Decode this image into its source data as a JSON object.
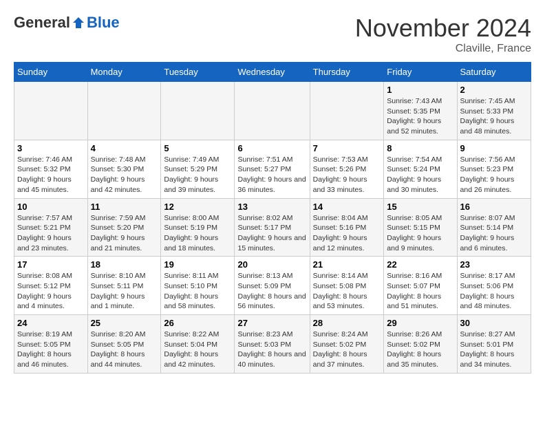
{
  "header": {
    "logo_general": "General",
    "logo_blue": "Blue",
    "month_title": "November 2024",
    "location": "Claville, France"
  },
  "weekdays": [
    "Sunday",
    "Monday",
    "Tuesday",
    "Wednesday",
    "Thursday",
    "Friday",
    "Saturday"
  ],
  "weeks": [
    [
      null,
      null,
      null,
      null,
      null,
      {
        "day": "1",
        "sunrise": "Sunrise: 7:43 AM",
        "sunset": "Sunset: 5:35 PM",
        "daylight": "Daylight: 9 hours and 52 minutes."
      },
      {
        "day": "2",
        "sunrise": "Sunrise: 7:45 AM",
        "sunset": "Sunset: 5:33 PM",
        "daylight": "Daylight: 9 hours and 48 minutes."
      }
    ],
    [
      {
        "day": "3",
        "sunrise": "Sunrise: 7:46 AM",
        "sunset": "Sunset: 5:32 PM",
        "daylight": "Daylight: 9 hours and 45 minutes."
      },
      {
        "day": "4",
        "sunrise": "Sunrise: 7:48 AM",
        "sunset": "Sunset: 5:30 PM",
        "daylight": "Daylight: 9 hours and 42 minutes."
      },
      {
        "day": "5",
        "sunrise": "Sunrise: 7:49 AM",
        "sunset": "Sunset: 5:29 PM",
        "daylight": "Daylight: 9 hours and 39 minutes."
      },
      {
        "day": "6",
        "sunrise": "Sunrise: 7:51 AM",
        "sunset": "Sunset: 5:27 PM",
        "daylight": "Daylight: 9 hours and 36 minutes."
      },
      {
        "day": "7",
        "sunrise": "Sunrise: 7:53 AM",
        "sunset": "Sunset: 5:26 PM",
        "daylight": "Daylight: 9 hours and 33 minutes."
      },
      {
        "day": "8",
        "sunrise": "Sunrise: 7:54 AM",
        "sunset": "Sunset: 5:24 PM",
        "daylight": "Daylight: 9 hours and 30 minutes."
      },
      {
        "day": "9",
        "sunrise": "Sunrise: 7:56 AM",
        "sunset": "Sunset: 5:23 PM",
        "daylight": "Daylight: 9 hours and 26 minutes."
      }
    ],
    [
      {
        "day": "10",
        "sunrise": "Sunrise: 7:57 AM",
        "sunset": "Sunset: 5:21 PM",
        "daylight": "Daylight: 9 hours and 23 minutes."
      },
      {
        "day": "11",
        "sunrise": "Sunrise: 7:59 AM",
        "sunset": "Sunset: 5:20 PM",
        "daylight": "Daylight: 9 hours and 21 minutes."
      },
      {
        "day": "12",
        "sunrise": "Sunrise: 8:00 AM",
        "sunset": "Sunset: 5:19 PM",
        "daylight": "Daylight: 9 hours and 18 minutes."
      },
      {
        "day": "13",
        "sunrise": "Sunrise: 8:02 AM",
        "sunset": "Sunset: 5:17 PM",
        "daylight": "Daylight: 9 hours and 15 minutes."
      },
      {
        "day": "14",
        "sunrise": "Sunrise: 8:04 AM",
        "sunset": "Sunset: 5:16 PM",
        "daylight": "Daylight: 9 hours and 12 minutes."
      },
      {
        "day": "15",
        "sunrise": "Sunrise: 8:05 AM",
        "sunset": "Sunset: 5:15 PM",
        "daylight": "Daylight: 9 hours and 9 minutes."
      },
      {
        "day": "16",
        "sunrise": "Sunrise: 8:07 AM",
        "sunset": "Sunset: 5:14 PM",
        "daylight": "Daylight: 9 hours and 6 minutes."
      }
    ],
    [
      {
        "day": "17",
        "sunrise": "Sunrise: 8:08 AM",
        "sunset": "Sunset: 5:12 PM",
        "daylight": "Daylight: 9 hours and 4 minutes."
      },
      {
        "day": "18",
        "sunrise": "Sunrise: 8:10 AM",
        "sunset": "Sunset: 5:11 PM",
        "daylight": "Daylight: 9 hours and 1 minute."
      },
      {
        "day": "19",
        "sunrise": "Sunrise: 8:11 AM",
        "sunset": "Sunset: 5:10 PM",
        "daylight": "Daylight: 8 hours and 58 minutes."
      },
      {
        "day": "20",
        "sunrise": "Sunrise: 8:13 AM",
        "sunset": "Sunset: 5:09 PM",
        "daylight": "Daylight: 8 hours and 56 minutes."
      },
      {
        "day": "21",
        "sunrise": "Sunrise: 8:14 AM",
        "sunset": "Sunset: 5:08 PM",
        "daylight": "Daylight: 8 hours and 53 minutes."
      },
      {
        "day": "22",
        "sunrise": "Sunrise: 8:16 AM",
        "sunset": "Sunset: 5:07 PM",
        "daylight": "Daylight: 8 hours and 51 minutes."
      },
      {
        "day": "23",
        "sunrise": "Sunrise: 8:17 AM",
        "sunset": "Sunset: 5:06 PM",
        "daylight": "Daylight: 8 hours and 48 minutes."
      }
    ],
    [
      {
        "day": "24",
        "sunrise": "Sunrise: 8:19 AM",
        "sunset": "Sunset: 5:05 PM",
        "daylight": "Daylight: 8 hours and 46 minutes."
      },
      {
        "day": "25",
        "sunrise": "Sunrise: 8:20 AM",
        "sunset": "Sunset: 5:05 PM",
        "daylight": "Daylight: 8 hours and 44 minutes."
      },
      {
        "day": "26",
        "sunrise": "Sunrise: 8:22 AM",
        "sunset": "Sunset: 5:04 PM",
        "daylight": "Daylight: 8 hours and 42 minutes."
      },
      {
        "day": "27",
        "sunrise": "Sunrise: 8:23 AM",
        "sunset": "Sunset: 5:03 PM",
        "daylight": "Daylight: 8 hours and 40 minutes."
      },
      {
        "day": "28",
        "sunrise": "Sunrise: 8:24 AM",
        "sunset": "Sunset: 5:02 PM",
        "daylight": "Daylight: 8 hours and 37 minutes."
      },
      {
        "day": "29",
        "sunrise": "Sunrise: 8:26 AM",
        "sunset": "Sunset: 5:02 PM",
        "daylight": "Daylight: 8 hours and 35 minutes."
      },
      {
        "day": "30",
        "sunrise": "Sunrise: 8:27 AM",
        "sunset": "Sunset: 5:01 PM",
        "daylight": "Daylight: 8 hours and 34 minutes."
      }
    ]
  ]
}
